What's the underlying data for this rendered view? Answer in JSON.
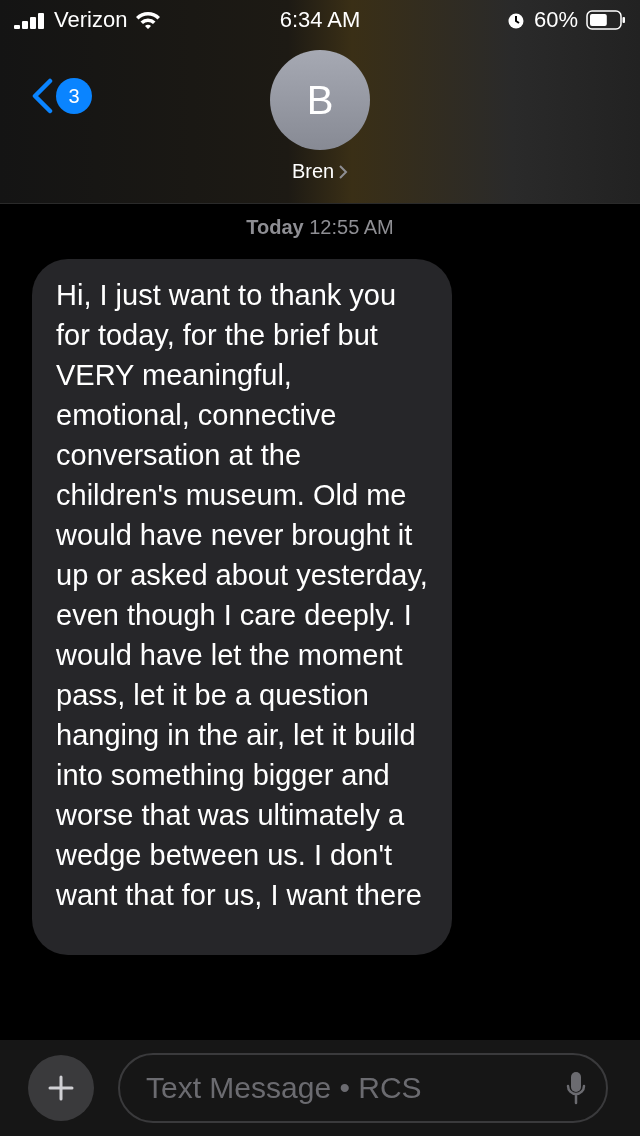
{
  "status_bar": {
    "carrier": "Verizon",
    "time": "6:34 AM",
    "battery": "60%"
  },
  "header": {
    "back_badge": "3",
    "avatar_initial": "B",
    "name": "Bren"
  },
  "conversation": {
    "timestamp": "**Today** 12:55 AM",
    "messages": [
      {
        "kind": "received",
        "text": "Hi, I just want to thank you for today, for the brief but VERY meaningful, emotional, connective conversation at the children's museum. Old me would have never brought it up or asked about yesterday, even though I care deeply. I would have let the moment pass, let it be a question hanging in the air, let it build into something bigger and worse that was ultimately a wedge between us. I don't want that for us, I want there"
      }
    ]
  },
  "composer": {
    "placeholder": "Text Message • RCS"
  }
}
